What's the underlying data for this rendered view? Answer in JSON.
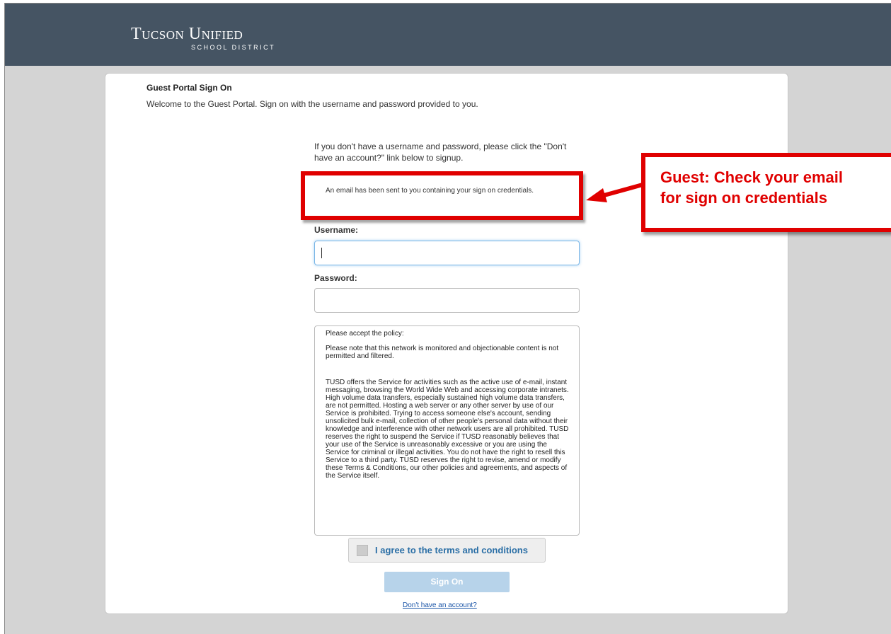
{
  "logo": {
    "main": "Tucson Unified",
    "sub": "SCHOOL DISTRICT"
  },
  "page": {
    "title": "Guest Portal Sign On",
    "welcome": "Welcome to the Guest Portal. Sign on with the username and password provided to you.",
    "info": "If you don't have a username and password, please click the \"Don't have an account?\" link below to signup.",
    "notice": "An email has been sent to you containing your sign on credentials."
  },
  "form": {
    "username_label": "Username:",
    "username_value": "",
    "password_label": "Password:",
    "password_value": ""
  },
  "policy": {
    "heading": "Please accept the policy:",
    "note": "Please note that this network is monitored and objectionable content is not permitted and filtered.",
    "body": "TUSD offers the Service for activities such as the active use of e-mail, instant messaging, browsing the World Wide Web and accessing corporate intranets. High volume data transfers, especially sustained high volume data transfers, are not permitted. Hosting a web server or any other server by use of our Service is prohibited. Trying to access someone else's account, sending unsolicited bulk e-mail, collection of other people's personal data without their knowledge and interference with other network users are all prohibited. TUSD reserves the right to suspend the Service if TUSD reasonably believes that your use of the Service is unreasonably excessive or you are using the Service for criminal or illegal activities. You do not have the right to resell this Service to a third party. TUSD reserves the right to revise, amend or modify these Terms & Conditions, our other policies and agreements, and aspects of the Service itself."
  },
  "agree": {
    "label": "I agree to the terms and conditions",
    "checked": false
  },
  "buttons": {
    "sign_on": "Sign On"
  },
  "links": {
    "no_account": "Don't have an account?"
  },
  "annotation": {
    "line1": "Guest: Check your email",
    "line2": "for sign on credentials"
  },
  "colors": {
    "header": "#455463",
    "accent_red": "#e00000",
    "button_disabled": "#b7d3ea",
    "link": "#1a55a8"
  }
}
